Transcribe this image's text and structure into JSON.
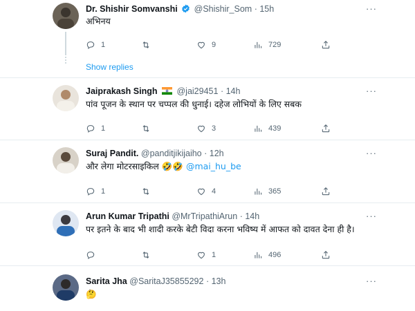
{
  "tweets": [
    {
      "name": "Dr. Shishir Somvanshi",
      "handle": "@Shishir_Som",
      "time": "15h",
      "verified": true,
      "text": "अभिनय",
      "replies": "1",
      "retweets": "",
      "likes": "9",
      "views": "729",
      "show_replies": "Show replies"
    },
    {
      "name": "Jaiprakash Singh",
      "handle": "@jai29451",
      "time": "14h",
      "flag": "india-flag-icon",
      "text": "पांव पूजन के स्थान पर चप्पल की धुनाई। दहेज लोभियों के लिए सबक",
      "replies": "1",
      "retweets": "",
      "likes": "3",
      "views": "439"
    },
    {
      "name": "Suraj Pandit.",
      "handle": "@panditjikijaiho",
      "time": "12h",
      "text": "और लेगा मोटरसाइकिल 🤣🤣",
      "mention": "@mai_hu_be",
      "replies": "1",
      "retweets": "",
      "likes": "4",
      "views": "365"
    },
    {
      "name": "Arun Kumar Tripathi",
      "handle": "@MrTripathiArun",
      "time": "14h",
      "text": "पर इतने के बाद भी शादी करके बेटी विदा करना भविष्य में आफत को दावत देना ही है।",
      "replies": "",
      "retweets": "",
      "likes": "1",
      "views": "496"
    },
    {
      "name": "Sarita Jha",
      "handle": "@SaritaJ35855292",
      "time": "13h",
      "text": "🤔"
    }
  ],
  "ui": {
    "separator": "·",
    "more": "···"
  },
  "colors": {
    "accent": "#1d9bf0",
    "secondary_text": "#536471",
    "divider": "#e6ecf0"
  }
}
